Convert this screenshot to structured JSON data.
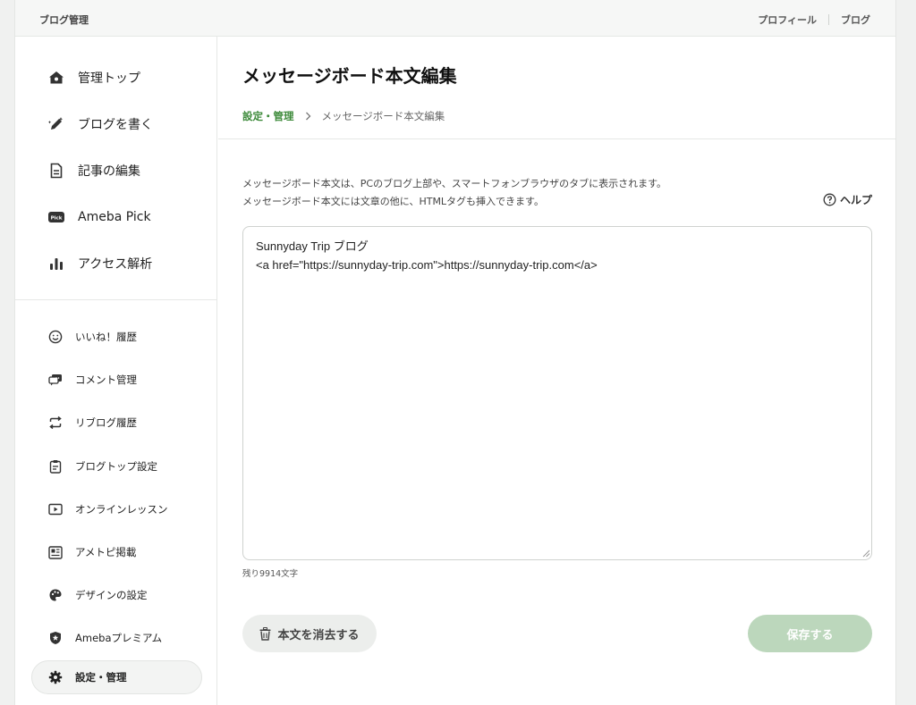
{
  "topbar": {
    "brand": "ブログ管理",
    "links": [
      "プロフィール",
      "ブログ"
    ]
  },
  "sidebar": {
    "main_items": [
      {
        "label": "管理トップ",
        "icon": "home-icon"
      },
      {
        "label": "ブログを書く",
        "icon": "pen-icon"
      },
      {
        "label": "記事の編集",
        "icon": "document-icon"
      },
      {
        "label": "Ameba Pick",
        "icon": "pick-icon"
      },
      {
        "label": "アクセス解析",
        "icon": "bar-chart-icon"
      }
    ],
    "sub_items": [
      {
        "label": "いいね！履歴",
        "icon": "smile-icon"
      },
      {
        "label": "コメント管理",
        "icon": "comment-icon"
      },
      {
        "label": "リブログ履歴",
        "icon": "reblog-icon"
      },
      {
        "label": "ブログトップ設定",
        "icon": "clipboard-icon"
      },
      {
        "label": "オンラインレッスン",
        "icon": "video-icon"
      },
      {
        "label": "アメトピ掲載",
        "icon": "newspaper-icon"
      },
      {
        "label": "デザインの設定",
        "icon": "palette-icon"
      },
      {
        "label": "Amebaプレミアム",
        "icon": "shield-star-icon"
      },
      {
        "label": "設定・管理",
        "icon": "gear-icon",
        "active": true
      }
    ],
    "pick_badge": "Pick"
  },
  "main": {
    "title": "メッセージボード本文編集",
    "breadcrumb": {
      "parent": "設定・管理",
      "current": "メッセージボード本文編集"
    },
    "description": [
      "メッセージボード本文は、PCのブログ上部や、スマートフォンブラウザのタブに表示されます。",
      "メッセージボード本文には文章の他に、HTMLタグも挿入できます。"
    ],
    "help_label": "ヘルプ",
    "editor_value": "Sunnyday Trip ブログ\n<a href=\"https://sunnyday-trip.com\">https://sunnyday-trip.com</a>",
    "counter": "残り9914文字",
    "clear_button": "本文を消去する",
    "save_button": "保存する"
  },
  "colors": {
    "accent_green": "#3d8a3a",
    "save_disabled": "#bcd7bc"
  }
}
